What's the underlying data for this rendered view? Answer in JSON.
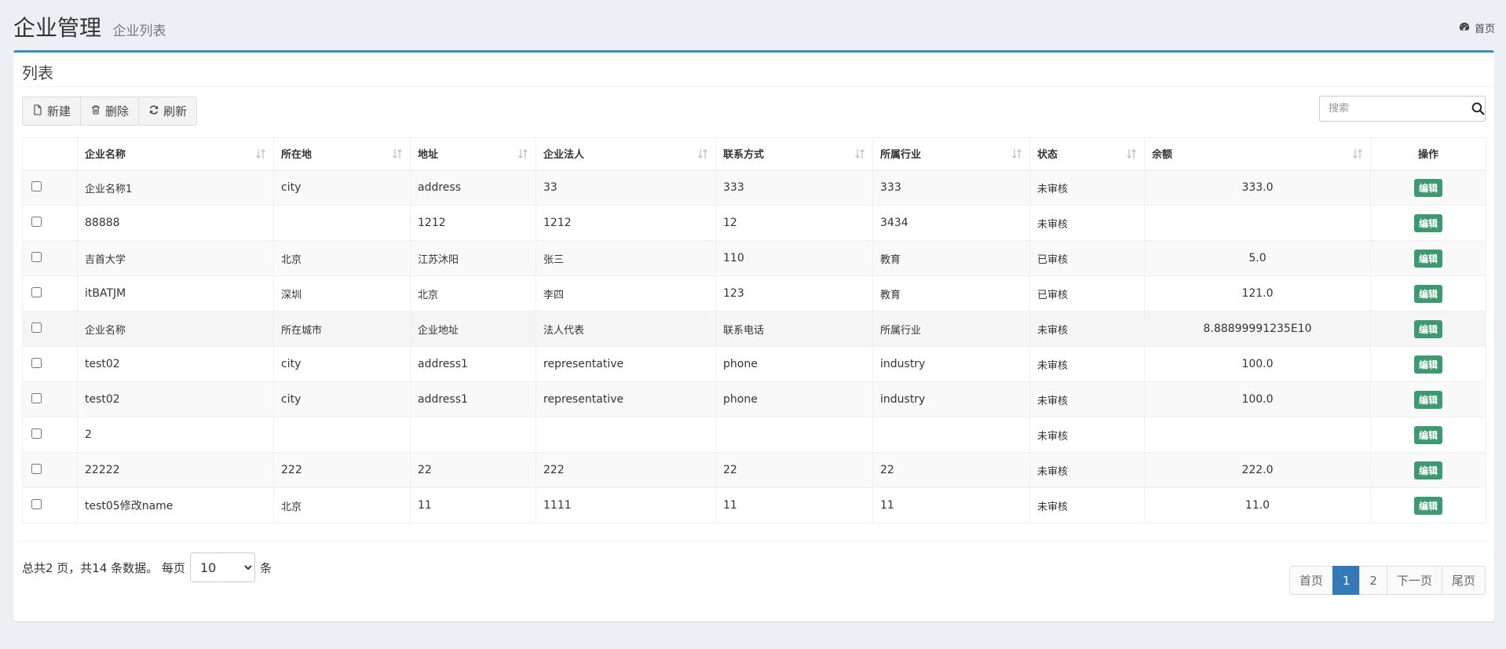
{
  "header": {
    "title": "企业管理",
    "subtitle": "企业列表",
    "breadcrumb_home": "首页"
  },
  "box": {
    "title": "列表"
  },
  "toolbar": {
    "new_label": "新建",
    "delete_label": "删除",
    "refresh_label": "刷新"
  },
  "search": {
    "placeholder": "搜索",
    "value": ""
  },
  "table": {
    "columns": [
      "企业名称",
      "所在地",
      "地址",
      "企业法人",
      "联系方式",
      "所属行业",
      "状态",
      "余额",
      "操作"
    ],
    "edit_label": "编辑",
    "rows": [
      {
        "name": "企业名称1",
        "city": "city",
        "address": "address",
        "legal": "33",
        "contact": "333",
        "industry": "333",
        "status": "未审核",
        "balance": "333.0"
      },
      {
        "name": "88888",
        "city": "",
        "address": "1212",
        "legal": "1212",
        "contact": "12",
        "industry": "3434",
        "status": "未审核",
        "balance": ""
      },
      {
        "name": "吉首大学",
        "city": "北京",
        "address": "江苏沐阳",
        "legal": "张三",
        "contact": "110",
        "industry": "教育",
        "status": "已审核",
        "balance": "5.0"
      },
      {
        "name": "itBATJM",
        "city": "深圳",
        "address": "北京",
        "legal": "李四",
        "contact": "123",
        "industry": "教育",
        "status": "已审核",
        "balance": "121.0"
      },
      {
        "name": "企业名称",
        "city": "所在城市",
        "address": "企业地址",
        "legal": "法人代表",
        "contact": "联系电话",
        "industry": "所属行业",
        "status": "未审核",
        "balance": "8.88899991235E10"
      },
      {
        "name": "test02",
        "city": "city",
        "address": "address1",
        "legal": "representative",
        "contact": "phone",
        "industry": "industry",
        "status": "未审核",
        "balance": "100.0"
      },
      {
        "name": "test02",
        "city": "city",
        "address": "address1",
        "legal": "representative",
        "contact": "phone",
        "industry": "industry",
        "status": "未审核",
        "balance": "100.0"
      },
      {
        "name": "2",
        "city": "",
        "address": "",
        "legal": "",
        "contact": "",
        "industry": "",
        "status": "未审核",
        "balance": ""
      },
      {
        "name": "22222",
        "city": "222",
        "address": "22",
        "legal": "222",
        "contact": "22",
        "industry": "22",
        "status": "未审核",
        "balance": "222.0"
      },
      {
        "name": "test05修改name",
        "city": "北京",
        "address": "11",
        "legal": "1111",
        "contact": "11",
        "industry": "11",
        "status": "未审核",
        "balance": "11.0"
      }
    ]
  },
  "footer": {
    "info_prefix": "总共2 页，共14 条数据。 每页",
    "page_size": "10",
    "info_suffix": "条",
    "pagination": {
      "first": "首页",
      "pages": [
        "1",
        "2"
      ],
      "next": "下一页",
      "last": "尾页"
    }
  },
  "colors": {
    "accent": "#3c8dbc",
    "edit_button": "#3d9970",
    "active_page": "#337ab7"
  }
}
